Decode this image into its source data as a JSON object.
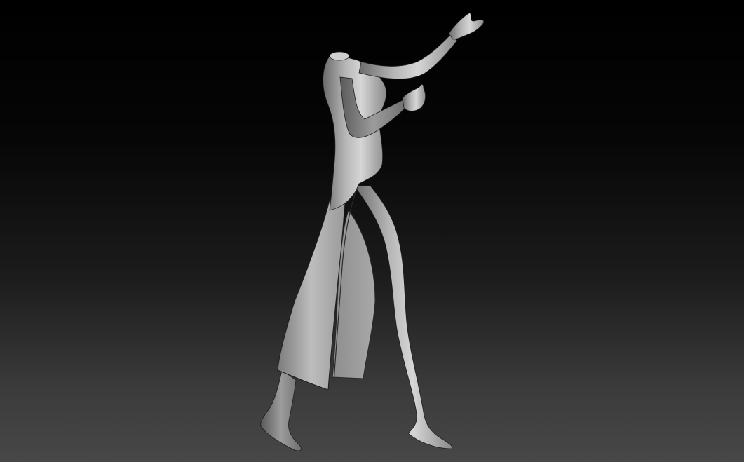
{
  "viewport": {
    "background_top": "#000000",
    "background_bottom": "#474747",
    "subject": "sculpt-figure",
    "material_color": "#b8b8b8"
  }
}
